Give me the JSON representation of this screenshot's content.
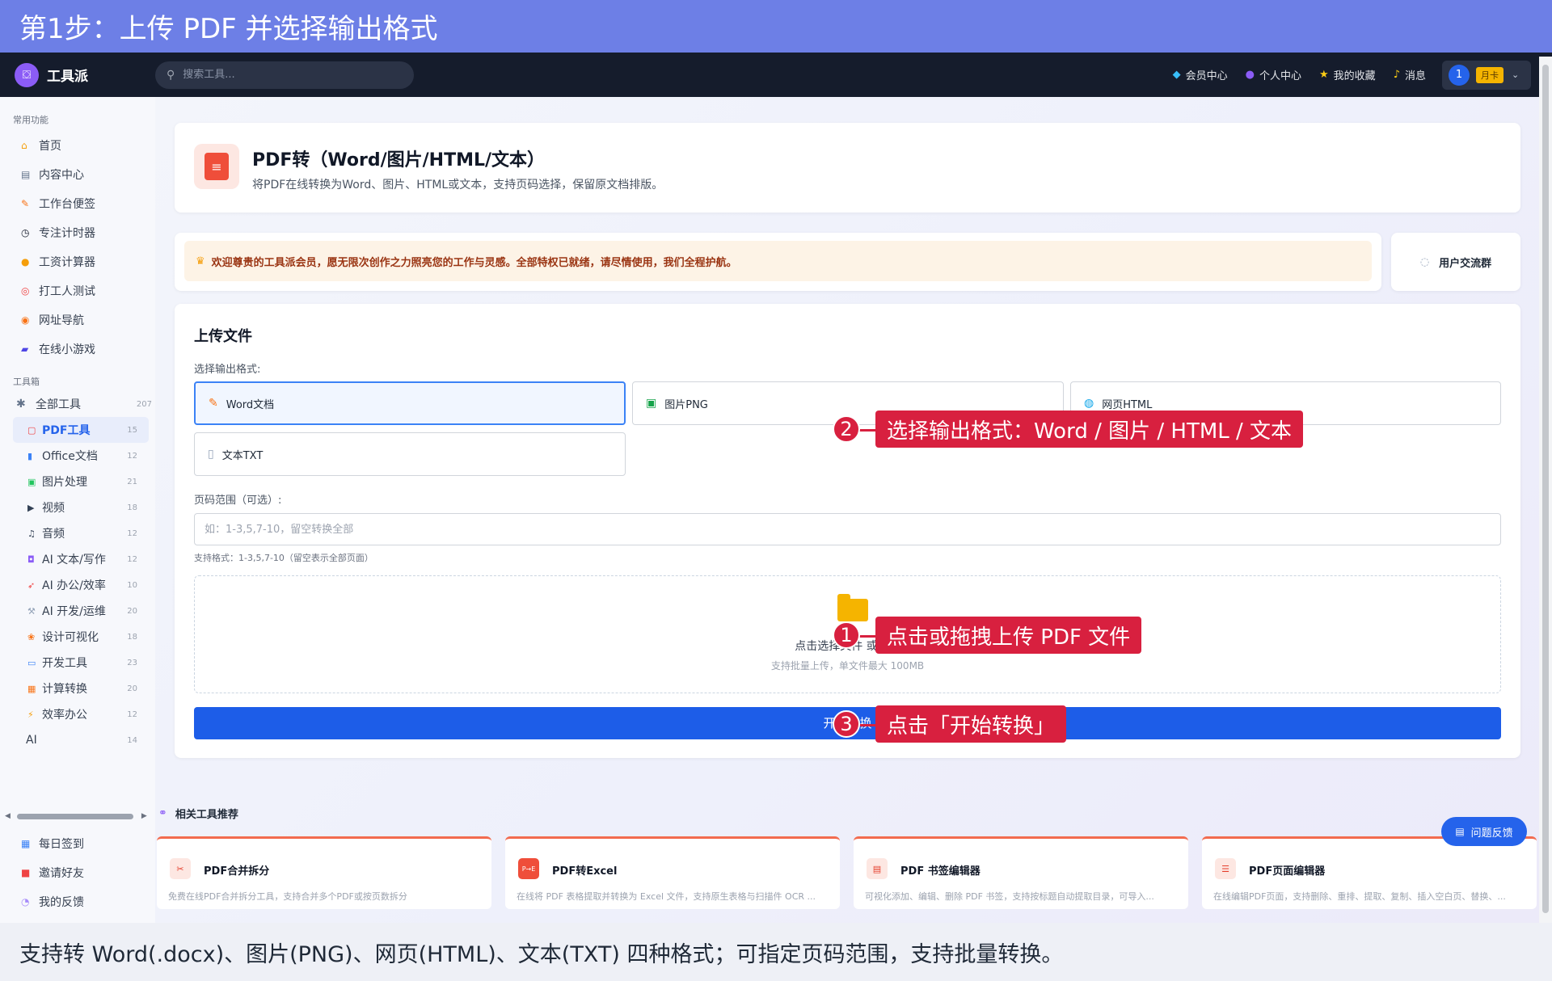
{
  "banner": {
    "title": "第1步：上传 PDF 并选择输出格式"
  },
  "topnav": {
    "app_name": "工具派",
    "search_placeholder": "搜索工具...",
    "links": [
      {
        "label": "会员中心",
        "icon": "diamond-icon"
      },
      {
        "label": "个人中心",
        "icon": "user-icon"
      },
      {
        "label": "我的收藏",
        "icon": "star-icon"
      },
      {
        "label": "消息",
        "icon": "bell-icon"
      }
    ],
    "user_number": "1",
    "user_badge": "月卡"
  },
  "sidebar": {
    "common_title": "常用功能",
    "common": [
      {
        "label": "首页",
        "icon": "home-icon"
      },
      {
        "label": "内容中心",
        "icon": "content-icon"
      },
      {
        "label": "工作台便签",
        "icon": "note-icon"
      },
      {
        "label": "专注计时器",
        "icon": "timer-icon"
      },
      {
        "label": "工资计算器",
        "icon": "money-icon"
      },
      {
        "label": "打工人测试",
        "icon": "target-icon"
      },
      {
        "label": "网址导航",
        "icon": "compass-icon"
      },
      {
        "label": "在线小游戏",
        "icon": "gamepad-icon"
      }
    ],
    "tools_title": "工具箱",
    "all_tools": {
      "label": "全部工具",
      "count": "207"
    },
    "tools": [
      {
        "label": "PDF工具",
        "count": "15",
        "active": true
      },
      {
        "label": "Office文档",
        "count": "12"
      },
      {
        "label": "图片处理",
        "count": "21"
      },
      {
        "label": "视频",
        "count": "18"
      },
      {
        "label": "音频",
        "count": "12"
      },
      {
        "label": "AI 文本/写作",
        "count": "12"
      },
      {
        "label": "AI 办公/效率",
        "count": "10"
      },
      {
        "label": "AI 开发/运维",
        "count": "20"
      },
      {
        "label": "设计可视化",
        "count": "18"
      },
      {
        "label": "开发工具",
        "count": "23"
      },
      {
        "label": "计算转换",
        "count": "20"
      },
      {
        "label": "效率办公",
        "count": "12"
      },
      {
        "label": "AI",
        "count": "14"
      }
    ],
    "bottom": [
      {
        "label": "每日签到",
        "icon": "calendar-icon"
      },
      {
        "label": "邀请好友",
        "icon": "gift-icon"
      },
      {
        "label": "我的反馈",
        "icon": "chat-icon"
      }
    ]
  },
  "page": {
    "title": "PDF转（Word/图片/HTML/文本）",
    "subtitle": "将PDF在线转换为Word、图片、HTML或文本，支持页码选择，保留原文档排版。",
    "welcome": "欢迎尊贵的工具派会员，愿无限次创作之力照亮您的工作与灵感。全部特权已就绪，请尽情使用，我们全程护航。",
    "group_button": "用户交流群"
  },
  "upload": {
    "heading": "上传文件",
    "format_label": "选择输出格式:",
    "formats": [
      {
        "label": "Word文档",
        "icon": "word-doc-icon",
        "selected": true
      },
      {
        "label": "图片PNG",
        "icon": "image-icon",
        "selected": false
      },
      {
        "label": "网页HTML",
        "icon": "globe-icon",
        "selected": false
      },
      {
        "label": "文本TXT",
        "icon": "text-file-icon",
        "selected": false
      }
    ],
    "range_label": "页码范围（可选）:",
    "range_placeholder": "如：1-3,5,7-10，留空转换全部",
    "range_hint": "支持格式：1-3,5,7-10（留空表示全部页面）",
    "drop_text": "点击选择文件 或拖拽",
    "drop_sub": "支持批量上传，单文件最大 100MB",
    "convert_label": "开始转换"
  },
  "related": {
    "title": "相关工具推荐",
    "cards": [
      {
        "title": "PDF合并拆分",
        "desc": "免费在线PDF合并拆分工具，支持合并多个PDF或按页数拆分",
        "icon": "scissors-icon"
      },
      {
        "title": "PDF转Excel",
        "desc": "在线将 PDF 表格提取并转换为 Excel 文件，支持原生表格与扫描件 OCR ...",
        "icon": "pdf-excel-icon"
      },
      {
        "title": "PDF 书签编辑器",
        "desc": "可视化添加、编辑、删除 PDF 书签，支持按标题自动提取目录，可导入...",
        "icon": "bookmark-icon"
      },
      {
        "title": "PDF页面编辑器",
        "desc": "在线编辑PDF页面，支持删除、重排、提取、复制、插入空白页、替换、...",
        "icon": "page-edit-icon"
      }
    ]
  },
  "feedback_button": "问题反馈",
  "annotations": [
    {
      "number": "2",
      "text": "选择输出格式：Word / 图片 / HTML / 文本"
    },
    {
      "number": "1",
      "text": "点击或拖拽上传 PDF 文件"
    },
    {
      "number": "3",
      "text": "点击「开始转换」"
    }
  ],
  "caption": "支持转 Word(.docx)、图片(PNG)、网页(HTML)、文本(TXT) 四种格式；可指定页码范围，支持批量转换。",
  "colors": {
    "banner": "#6d7fe6",
    "nav": "#151c2c",
    "accent": "#1d5de8",
    "callout": "#d8203f"
  }
}
